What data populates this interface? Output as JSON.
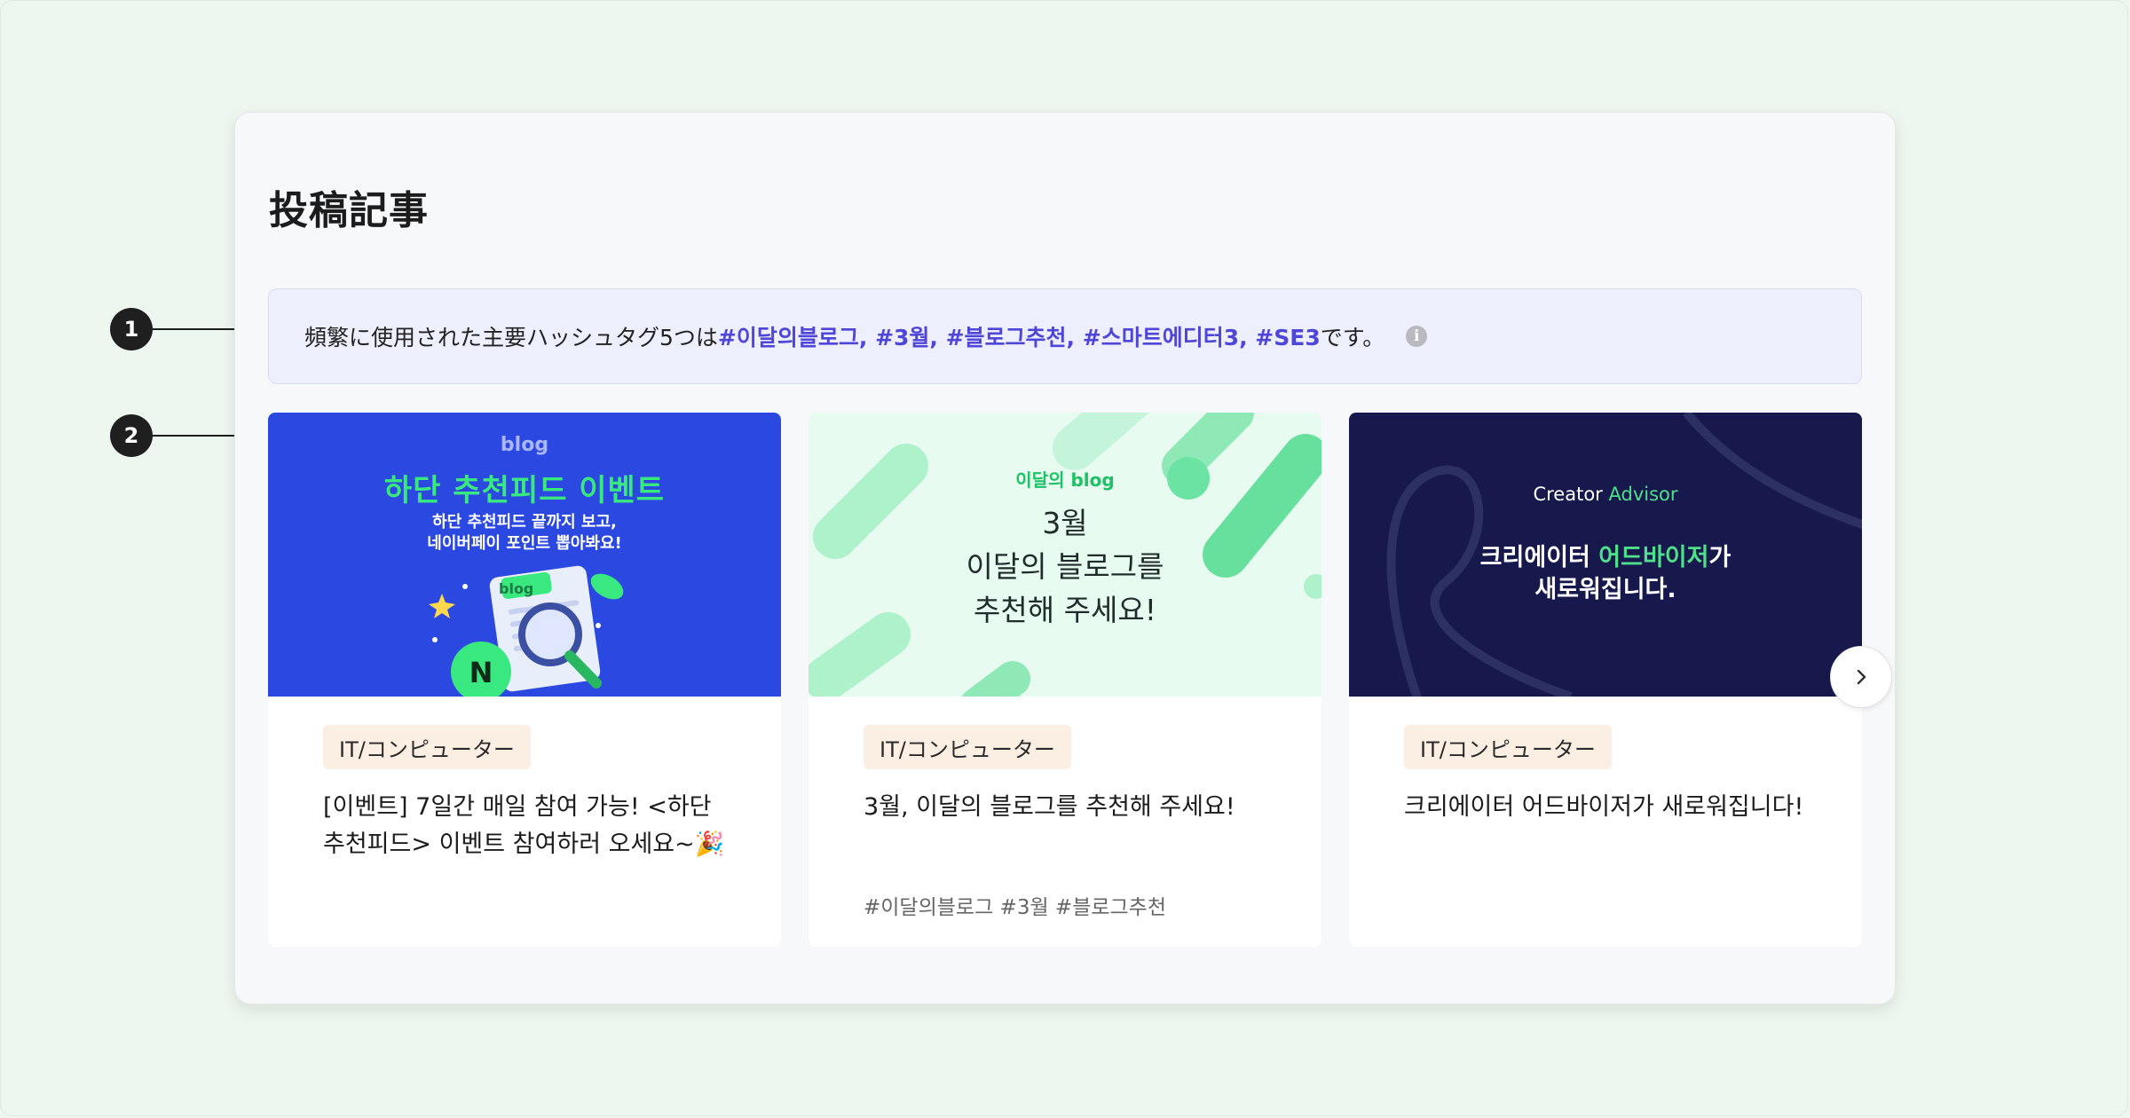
{
  "callouts": [
    "1",
    "2"
  ],
  "page": {
    "title": "投稿記事"
  },
  "hashtag_notice": {
    "prefix": "頻繁に使用された主要ハッシュタグ5つは",
    "tags": "#이달의블로그, #3월, #블로그추천, #스마트에디터3, #SE3",
    "suffix": "です。",
    "info_icon_label": "i"
  },
  "cards": [
    {
      "thumb": {
        "brand": "blog",
        "headline": "하단 추천피드 이벤트",
        "sub_line1": "하단 추천피드 끝까지 보고,",
        "sub_line2": "네이버페이 포인트 뽑아봐요!",
        "sticker": "blog",
        "coin": "N"
      },
      "category": "IT/コンピューター",
      "title": "[이벤트] 7일간 매일 참여 가능! <하단 추천피드> 이벤트 참여하러 오세요~🎉",
      "tags": ""
    },
    {
      "thumb": {
        "brand": "이달의 blog",
        "line1": "3월",
        "line2": "이달의 블로그를",
        "line3": "추천해 주세요!"
      },
      "category": "IT/コンピューター",
      "title": "3월, 이달의 블로그를 추천해 주세요!",
      "tags": "#이달의블로그 #3월 #블로그추천"
    },
    {
      "thumb": {
        "brand_a": "Creator",
        "brand_b": "Advisor",
        "line1_a": "크리에이터 ",
        "line1_b": "어드바이저",
        "line1_c": "가",
        "line2": "새로워집니다."
      },
      "category": "IT/コンピューター",
      "title": "크리에이터 어드바이저가 새로워집니다!",
      "tags": ""
    }
  ],
  "colors": {
    "background": "#eef7ef",
    "hashtag_accent": "#4f46d8",
    "category_bg": "#fbefe3",
    "thumb1_bg": "#2b49e0",
    "thumb2_bg": "#e7fbf1",
    "thumb3_bg": "#17194d",
    "brand_green": "#39e87f"
  },
  "icons": {
    "next": "chevron-right-icon",
    "info": "info-icon"
  }
}
